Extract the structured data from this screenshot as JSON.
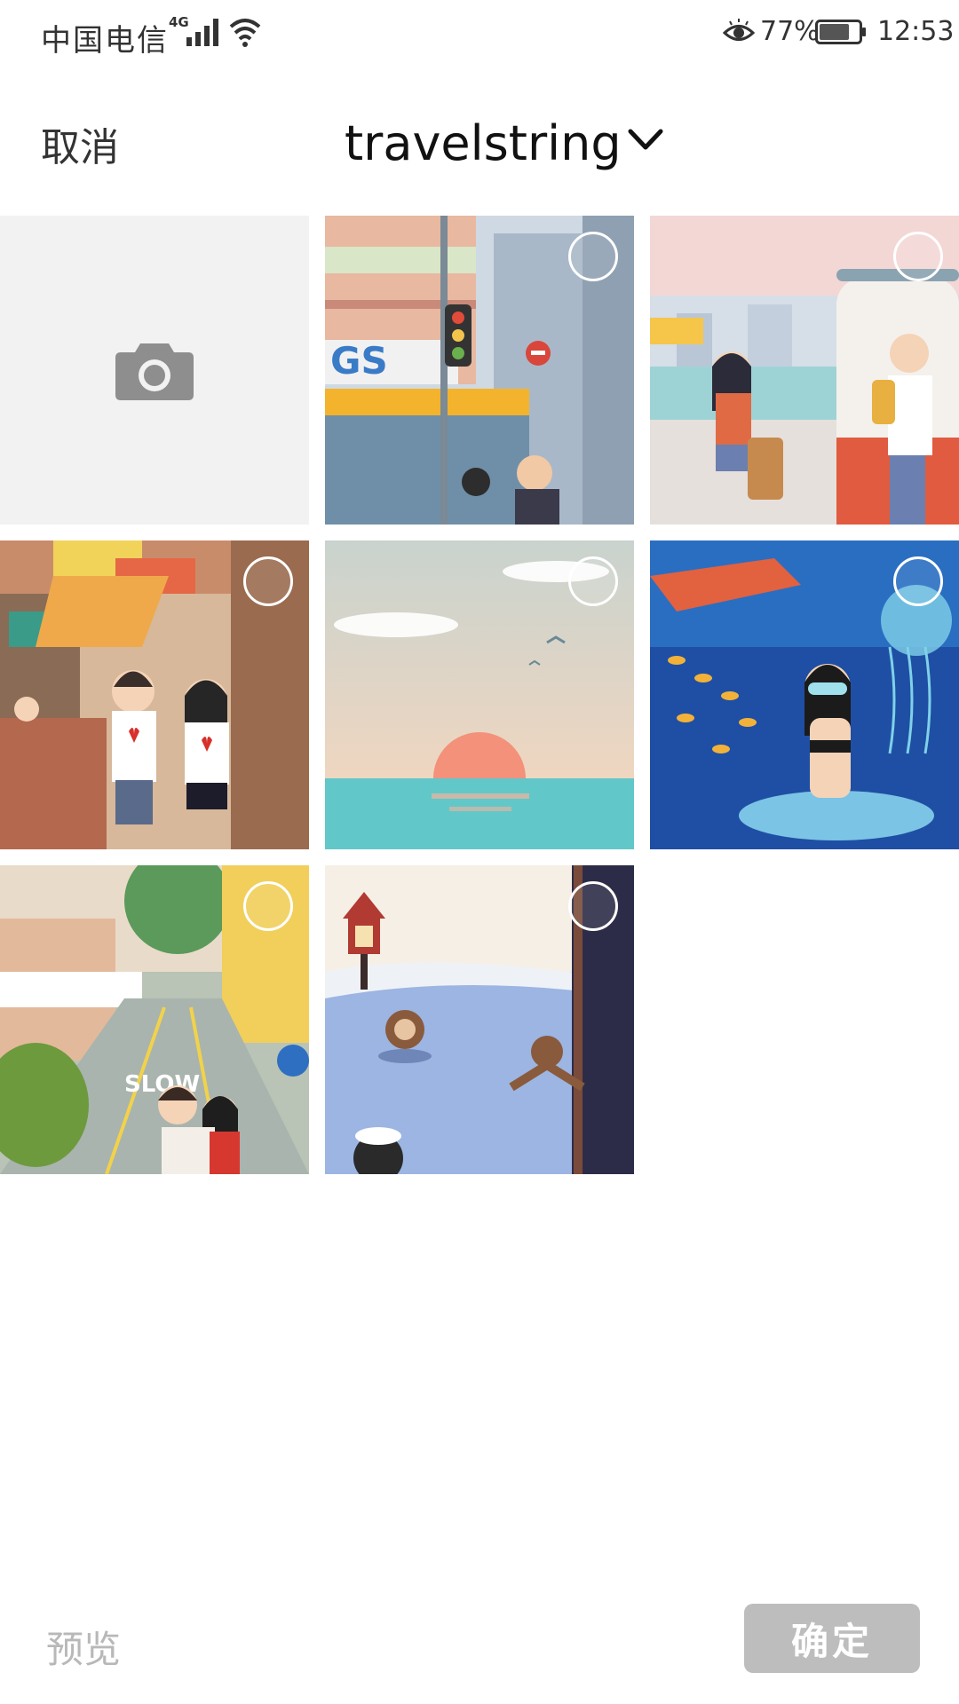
{
  "status_bar": {
    "carrier": "中国电信",
    "network": "4G",
    "battery_percent": "77%",
    "battery_level": 0.77,
    "time": "12:53"
  },
  "header": {
    "cancel_label": "取消",
    "album_title": "travelstring",
    "dropdown_icon": "chevron-down-icon"
  },
  "grid": {
    "camera_icon": "camera-icon",
    "photos": [
      {
        "name": "street-corner-gs25"
      },
      {
        "name": "tram-stop"
      },
      {
        "name": "market-street"
      },
      {
        "name": "sunset-sea"
      },
      {
        "name": "underwater-dolphin"
      },
      {
        "name": "slow-street"
      },
      {
        "name": "snow-hot-spring"
      }
    ]
  },
  "footer": {
    "preview_label": "预览",
    "confirm_label": "确定"
  }
}
